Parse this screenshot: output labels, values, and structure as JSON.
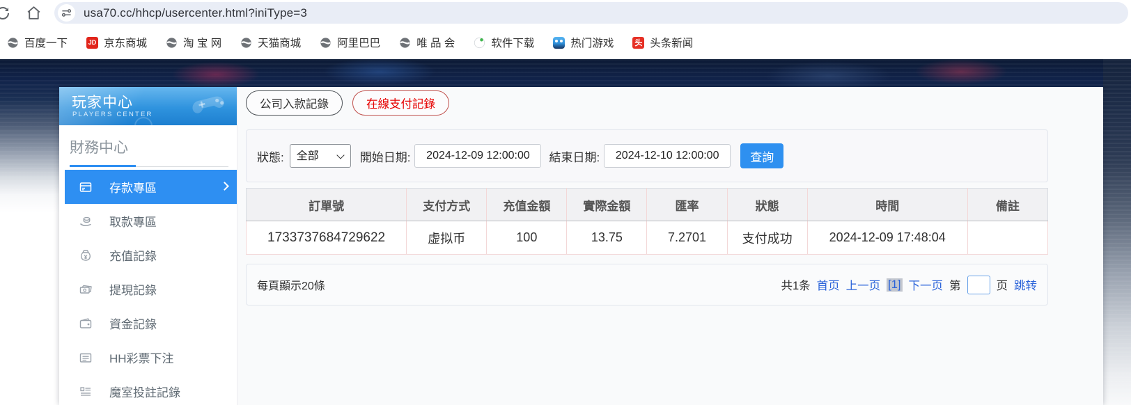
{
  "browser": {
    "url": "usa70.cc/hhcp/usercenter.html?iniType=3",
    "bookmarks": [
      {
        "label": "百度一下",
        "icon": "globe-icon"
      },
      {
        "label": "京东商城",
        "icon": "jd-icon",
        "badge": "JD"
      },
      {
        "label": "淘 宝 网",
        "icon": "globe-icon"
      },
      {
        "label": "天猫商城",
        "icon": "globe-icon"
      },
      {
        "label": "阿里巴巴",
        "icon": "globe-icon"
      },
      {
        "label": "唯 品 会",
        "icon": "globe-icon"
      },
      {
        "label": "软件下载",
        "icon": "software-download-icon"
      },
      {
        "label": "热门游戏",
        "icon": "game-robot-icon"
      },
      {
        "label": "头条新闻",
        "icon": "toutiao-icon",
        "badge": "头"
      }
    ]
  },
  "sidebar": {
    "title": "玩家中心",
    "subtitle": "PLAYERS CENTER",
    "section": "財務中心",
    "items": [
      {
        "label": "存款專區",
        "icon": "deposit-card-icon",
        "active": true
      },
      {
        "label": "取款專區",
        "icon": "withdraw-hand-icon",
        "active": false
      },
      {
        "label": "充值記錄",
        "icon": "recharge-bag-icon",
        "active": false
      },
      {
        "label": "提現記錄",
        "icon": "cash-notes-icon",
        "active": false
      },
      {
        "label": "資金記錄",
        "icon": "funds-wallet-icon",
        "active": false
      },
      {
        "label": "HH彩票下注",
        "icon": "lottery-list-icon",
        "active": false
      },
      {
        "label": "魔室投註記錄",
        "icon": "bet-record-icon",
        "active": false
      }
    ]
  },
  "main": {
    "tabs": [
      {
        "label": "公司入款記錄",
        "active": false
      },
      {
        "label": "在線支付記錄",
        "active": true
      }
    ],
    "filters": {
      "status_label": "狀態:",
      "status_value": "全部",
      "start_label": "開始日期:",
      "start_value": "2024-12-09 12:00:00",
      "end_label": "結束日期:",
      "end_value": "2024-12-10 12:00:00",
      "search_label": "查詢"
    },
    "table": {
      "headers": [
        "訂單號",
        "支付方式",
        "充值金額",
        "實際金額",
        "匯率",
        "狀態",
        "時間",
        "備註"
      ],
      "rows": [
        [
          "1733737684729622",
          "虚拟币",
          "100",
          "13.75",
          "7.2701",
          "支付成功",
          "2024-12-09 17:48:04",
          ""
        ]
      ]
    },
    "pagination": {
      "page_size_text": "每頁顯示20條",
      "total_text": "共1条",
      "first": "首页",
      "prev": "上一页",
      "current": "[1]",
      "next": "下一页",
      "jump_pre": "第",
      "jump_value": "",
      "jump_post": "页",
      "jump_action": "跳转"
    }
  },
  "colors": {
    "accent_blue": "#2e90f0",
    "link_blue": "#2b63d9",
    "active_tab_red": "#e60000",
    "banner_blue": "#2f93de",
    "jd_red": "#e1251b",
    "toutiao_red": "#e63025"
  }
}
